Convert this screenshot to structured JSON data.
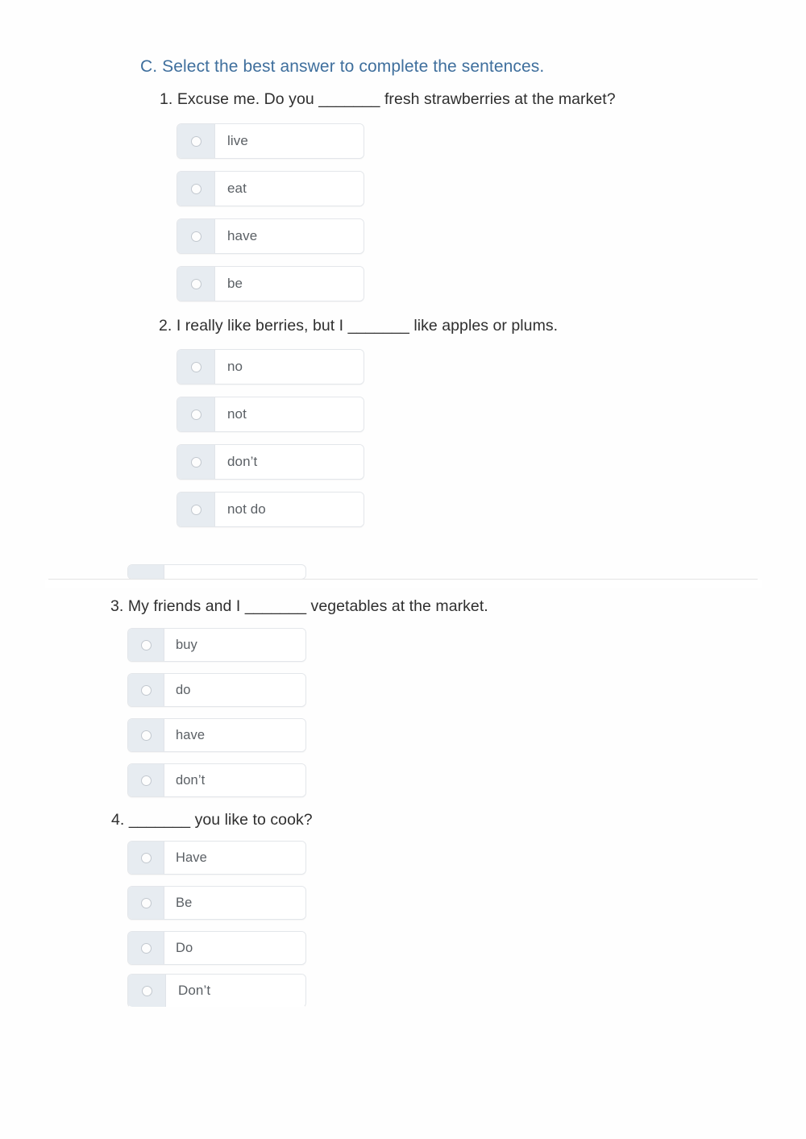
{
  "worksheet": {
    "section": {
      "label": "C. Select the best answer to complete the sentences."
    },
    "questions": [
      {
        "number": "1.",
        "prompt": "1. Excuse me. Do you _______ fresh strawberries at the market?",
        "options": [
          {
            "label": "live",
            "selected": false
          },
          {
            "label": "eat",
            "selected": false
          },
          {
            "label": "have",
            "selected": false
          },
          {
            "label": "be",
            "selected": false
          }
        ]
      },
      {
        "number": "2.",
        "prompt": "2. I really like berries, but I _______ like apples or plums.",
        "options": [
          {
            "label": "no",
            "selected": false
          },
          {
            "label": "not",
            "selected": false
          },
          {
            "label": "don’t",
            "selected": false
          },
          {
            "label": "not do",
            "selected": false
          }
        ]
      },
      {
        "number": "3.",
        "prompt": "3. My friends and I _______ vegetables at the market.",
        "options": [
          {
            "label": "buy",
            "selected": false
          },
          {
            "label": "do",
            "selected": false
          },
          {
            "label": "have",
            "selected": false
          },
          {
            "label": "don’t",
            "selected": false
          }
        ]
      },
      {
        "number": "4.",
        "prompt": "4. _______ you like to cook?",
        "options": [
          {
            "label": "Have",
            "selected": false
          },
          {
            "label": "Be",
            "selected": false
          },
          {
            "label": "Do",
            "selected": false
          },
          {
            "label": "Don’t",
            "selected": false
          }
        ]
      }
    ],
    "colors": {
      "heading": "#3f6f9d",
      "body_text": "#2f2f2f",
      "option_text": "#5b6065",
      "radio_panel": "#e7ecf1",
      "box_border": "#e3e6ea",
      "page_divider": "#e4e4e4",
      "page_background": "#ffffff"
    }
  }
}
